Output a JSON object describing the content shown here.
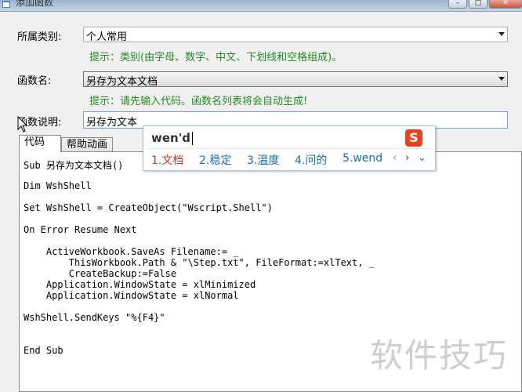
{
  "window": {
    "title": "添加函数",
    "min_label": "–",
    "max_label": "□",
    "close_label": "✕"
  },
  "form": {
    "category_label": "所属类别:",
    "category_value": "个人常用",
    "category_hint": "提示：类别(由字母、数字、中文、下划线和空格组成)。",
    "funcname_label": "函数名:",
    "funcname_value": "另存为文本文档",
    "funcname_hint": "提示：请先输入代码。函数名列表将会自动生成!",
    "desc_label": "函数说明:",
    "desc_value": "另存为文本"
  },
  "tabs": {
    "code": "代码",
    "animation": "帮助动画"
  },
  "code_lines": [
    "Sub 另存为文本文档()",
    "Dim WshShell",
    "Set WshShell = CreateObject(\"Wscript.Shell\")",
    "On Error Resume Next",
    "    ActiveWorkbook.SaveAs Filename:= _",
    "        ThisWorkbook.Path & \"\\Step.txt\", FileFormat:=xlText, _",
    "        CreateBackup:=False",
    "    Application.WindowState = xlMinimized",
    "    Application.WindowState = xlNormal",
    "WshShell.SendKeys \"%{F4}\"",
    "End Sub"
  ],
  "ime": {
    "composition": "wen'd",
    "logo": "S",
    "candidates": [
      "1.文档",
      "2.稳定",
      "3.温度",
      "4.问的",
      "5.wend"
    ],
    "nav_prev": "‹",
    "nav_next": "›",
    "nav_more": "⌄"
  },
  "watermark": "软件技巧"
}
